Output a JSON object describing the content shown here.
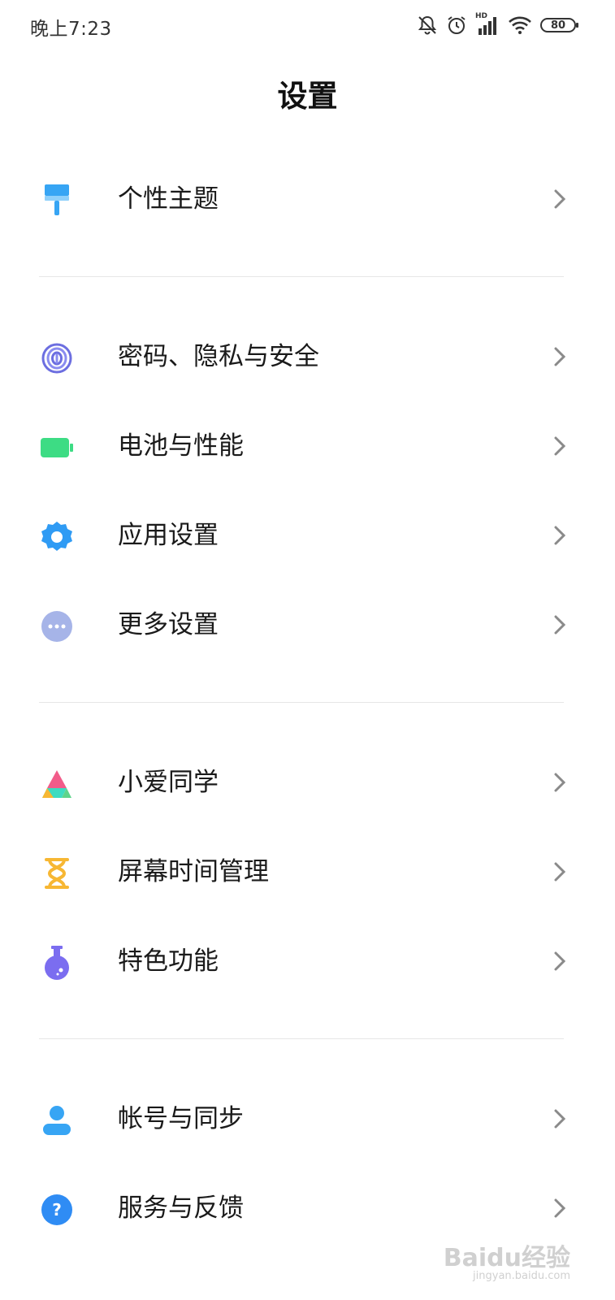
{
  "status_bar": {
    "time": "晚上7:23",
    "network_label": "HD",
    "battery_level": "80",
    "icons": [
      "mute-bell-icon",
      "alarm-icon",
      "signal-icon",
      "wifi-icon",
      "battery-icon"
    ]
  },
  "page": {
    "title": "设置"
  },
  "settings": {
    "items": [
      {
        "label": "个性主题",
        "icon": "paint-roller-icon",
        "color": "#37a5f4"
      },
      {
        "label": "密码、隐私与安全",
        "icon": "fingerprint-icon",
        "color": "#6c6ee0"
      },
      {
        "label": "电池与性能",
        "icon": "battery-icon",
        "color": "#3ddc84"
      },
      {
        "label": "应用设置",
        "icon": "gear-icon",
        "color": "#2f9bf4"
      },
      {
        "label": "更多设置",
        "icon": "more-dots-icon",
        "color": "#a6b4e8"
      },
      {
        "label": "小爱同学",
        "icon": "xiaoai-icon",
        "color": "#f25c8a"
      },
      {
        "label": "屏幕时间管理",
        "icon": "hourglass-icon",
        "color": "#f7b733"
      },
      {
        "label": "特色功能",
        "icon": "flask-icon",
        "color": "#7b6df0"
      },
      {
        "label": "帐号与同步",
        "icon": "user-icon",
        "color": "#37a5f4"
      },
      {
        "label": "服务与反馈",
        "icon": "help-icon",
        "color": "#2f8cf4"
      }
    ]
  },
  "watermark": {
    "brand": "Baidu经验",
    "url": "jingyan.baidu.com"
  }
}
